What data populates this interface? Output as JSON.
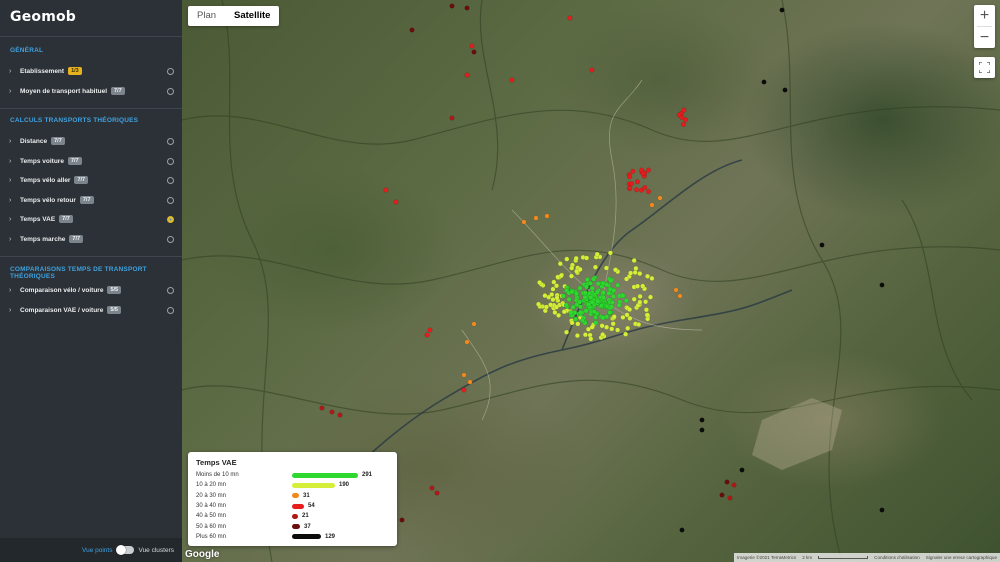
{
  "app": {
    "logo": "Geomob"
  },
  "sections": [
    {
      "title": "GÉNÉRAL",
      "items": [
        {
          "label": "Etablissement",
          "badge": "1/3",
          "badge_color": "yellow",
          "checked": false
        },
        {
          "label": "Moyen de transport habituel",
          "badge": "7/7",
          "badge_color": "gray",
          "checked": false
        }
      ]
    },
    {
      "title": "CALCULS TRANSPORTS THÉORIQUES",
      "items": [
        {
          "label": "Distance",
          "badge": "7/7",
          "badge_color": "gray",
          "checked": false
        },
        {
          "label": "Temps voiture",
          "badge": "7/7",
          "badge_color": "gray",
          "checked": false
        },
        {
          "label": "Temps vélo aller",
          "badge": "7/7",
          "badge_color": "gray",
          "checked": false
        },
        {
          "label": "Temps vélo retour",
          "badge": "7/7",
          "badge_color": "gray",
          "checked": false
        },
        {
          "label": "Temps VAE",
          "badge": "7/7",
          "badge_color": "gray",
          "checked": true
        },
        {
          "label": "Temps marche",
          "badge": "7/7",
          "badge_color": "gray",
          "checked": false
        }
      ]
    },
    {
      "title": "COMPARAISONS TEMPS DE TRANSPORT THÉORIQUES",
      "items": [
        {
          "label": "Comparaison vélo / voiture",
          "badge": "5/5",
          "badge_color": "gray",
          "checked": false
        },
        {
          "label": "Comparaison VAE / voiture",
          "badge": "5/5",
          "badge_color": "gray",
          "checked": false
        }
      ]
    }
  ],
  "footer": {
    "view_points": "Vue points",
    "view_clusters": "Vue clusters"
  },
  "map": {
    "type_plan": "Plan",
    "type_satellite": "Satellite",
    "active_type": "Satellite",
    "zoom_in": "+",
    "zoom_out": "−",
    "google": "Google",
    "attribution": {
      "imagery": "Imagerie ©2021 TerraMetrics",
      "scale": "2 km",
      "terms": "Conditions d'utilisation",
      "report": "Signaler une erreur cartographique"
    }
  },
  "legend": {
    "title": "Temps VAE",
    "rows": [
      {
        "label": "Moins de 10 mn",
        "count": 291,
        "color": "#2fd82f"
      },
      {
        "label": "10 à 20 mn",
        "count": 190,
        "color": "#d4ee3a"
      },
      {
        "label": "20 à 30 mn",
        "count": 31,
        "color": "#f08a20"
      },
      {
        "label": "30 à 40 mn",
        "count": 54,
        "color": "#e51d1d"
      },
      {
        "label": "40 à 50 mn",
        "count": 21,
        "color": "#b01818"
      },
      {
        "label": "50 à 60 mn",
        "count": 37,
        "color": "#6b0c0c"
      },
      {
        "label": "Plus 60 mn",
        "count": 129,
        "color": "#0b0b0b"
      }
    ]
  }
}
